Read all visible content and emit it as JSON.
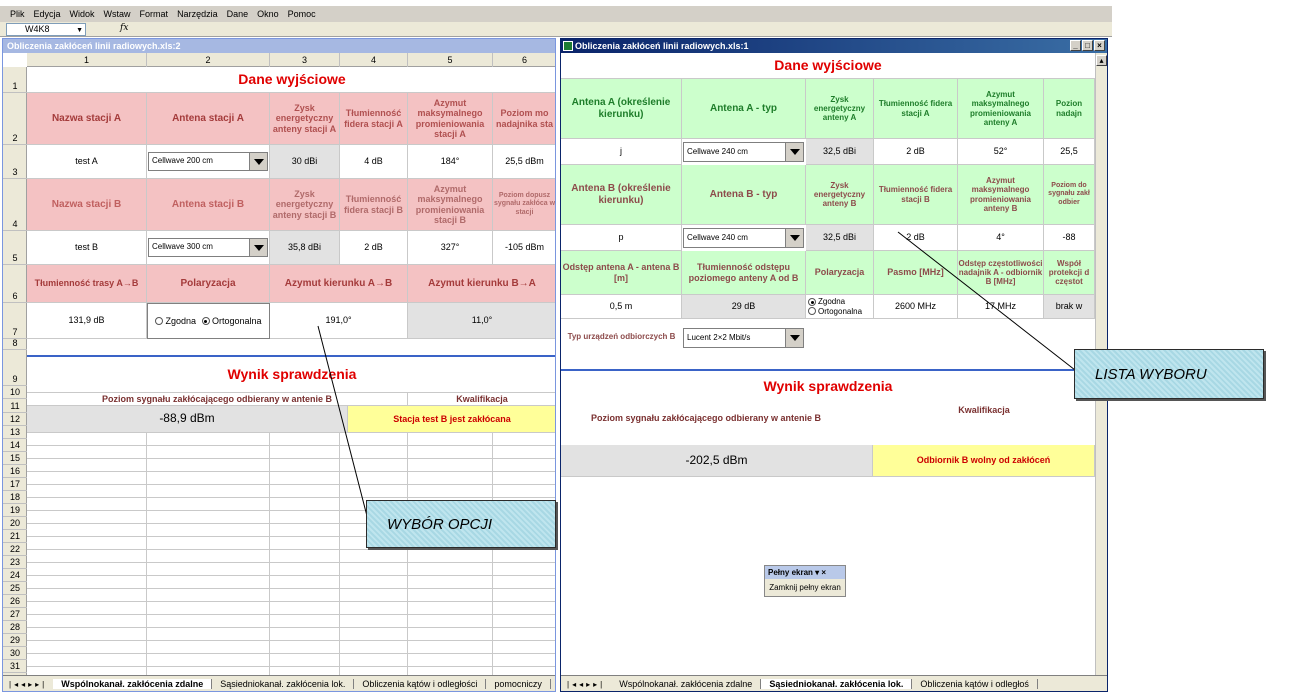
{
  "menu": {
    "items": [
      {
        "label": "Plik",
        "key": "P"
      },
      {
        "label": "Edycja",
        "key": "E"
      },
      {
        "label": "Widok",
        "key": "W"
      },
      {
        "label": "Wstaw",
        "key": "s"
      },
      {
        "label": "Format",
        "key": "F"
      },
      {
        "label": "Narzędzia",
        "key": "N"
      },
      {
        "label": "Dane",
        "key": "D"
      },
      {
        "label": "Okno",
        "key": "O"
      },
      {
        "label": "Pomoc",
        "key": "m"
      }
    ]
  },
  "formula_bar": {
    "name_box": "W4K8",
    "fx": "fx"
  },
  "left_window": {
    "title": "Obliczenia zakłóceń linii radiowych.xls:2",
    "columns": [
      "1",
      "2",
      "3",
      "4",
      "5",
      "6"
    ],
    "rows": [
      "1",
      "2",
      "3",
      "4",
      "5",
      "6",
      "7",
      "8",
      "9",
      "10",
      "11",
      "12",
      "13",
      "14",
      "15",
      "16",
      "17",
      "18",
      "19",
      "20",
      "21",
      "22",
      "23",
      "24",
      "25",
      "26",
      "27",
      "28",
      "29",
      "30",
      "31"
    ],
    "section_title": "Dane wyjściowe",
    "station_a": {
      "h_name": "Nazwa stacji A",
      "h_antenna": "Antena stacji A",
      "h_gain": "Zysk energetyczny anteny stacji A",
      "h_loss": "Tłumienność fidera stacji A",
      "h_azimuth": "Azymut maksymalnego promieniowania stacji A",
      "h_power": "Poziom mo nadajnika sta",
      "name": "test A",
      "antenna": "Cellwave 200 cm",
      "gain": "30 dBi",
      "loss": "4 dB",
      "azimuth": "184°",
      "power": "25,5 dBm"
    },
    "station_b": {
      "h_name": "Nazwa stacji B",
      "h_antenna": "Antena stacji B",
      "h_gain": "Zysk energetyczny anteny stacji B",
      "h_loss": "Tłumienność fidera stacji B",
      "h_azimuth": "Azymut maksymalnego promieniowania stacji B",
      "h_level": "Poziom dopusz sygnału zakłóca w stacji",
      "name": "test B",
      "antenna": "Cellwave 300 cm",
      "gain": "35,8 dBi",
      "loss": "2 dB",
      "azimuth": "327°",
      "level": "-105 dBm"
    },
    "route": {
      "h_attenuation": "Tłumienność trasy A→B",
      "h_polarization": "Polaryzacja",
      "h_az_ab": "Azymut kierunku A→B",
      "h_az_ba": "Azymut kierunku B→A",
      "attenuation": "131,9 dB",
      "pol_opt1": "Zgodna",
      "pol_opt2": "Ortogonalna",
      "az_ab": "191,0°",
      "az_ba": "11,0°"
    },
    "result_title": "Wynik sprawdzenia",
    "h_signal": "Poziom sygnału zakłócającego odbierany w antenie B",
    "h_qual": "Kwalifikacja",
    "signal": "-88,9 dBm",
    "qual": "Stacja test B jest zakłócana",
    "tabs": [
      "Wspólnokanał. zakłócenia zdalne",
      "Sąsiedniokanał. zakłócenia lok.",
      "Obliczenia kątów i odległości",
      "pomocniczy"
    ]
  },
  "right_window": {
    "title": "Obliczenia zakłóceń linii radiowych.xls:1",
    "section_title": "Dane wyjściowe",
    "antenna_a": {
      "h_dir": "Antena A (określenie kierunku)",
      "h_type": "Antena A - typ",
      "h_gain": "Zysk energetyczny anteny A",
      "h_loss": "Tłumienność fidera stacji A",
      "h_azimuth": "Azymut maksymalnego promieniowania anteny A",
      "h_power": "Pozion nadajn",
      "dir": "j",
      "type": "Cellwave 240 cm",
      "gain": "32,5 dBi",
      "loss": "2 dB",
      "azimuth": "52°",
      "power": "25,5"
    },
    "antenna_b": {
      "h_dir": "Antena B (określenie kierunku)",
      "h_type": "Antena B - typ",
      "h_gain": "Zysk energetyczny anteny B",
      "h_loss": "Tłumienność fidera stacji B",
      "h_azimuth": "Azymut maksymalnego promieniowania anteny B",
      "h_level": "Poziom do sygnału zakł odbier",
      "dir": "p",
      "type": "Cellwave 240 cm",
      "gain": "32,5 dBi",
      "loss": "2 dB",
      "azimuth": "4°",
      "level": "-88"
    },
    "link": {
      "h_distance": "Odstęp antena A - antena B [m]",
      "h_hatt": "Tłumienność odstępu poziomego anteny A od B",
      "h_pol": "Polaryzacja",
      "h_band": "Pasmo [MHz]",
      "h_freq": "Odstęp częstotliwości nadajnik A - odbiornik B [MHz]",
      "h_prot": "Współ protekcji d częstot",
      "distance": "0,5 m",
      "hatt": "29 dB",
      "pol_opt1": "Zgodna",
      "pol_opt2": "Ortogonalna",
      "band": "2600 MHz",
      "freq": "17 MHz",
      "prot": "brak w"
    },
    "receiver_label": "Typ urządzeń odbiorczych B",
    "receiver": "Lucent 2×2 Mbit/s",
    "result_title": "Wynik sprawdzenia",
    "h_signal": "Poziom sygnału zakłócającego odbierany w antenie B",
    "h_qual": "Kwalifikacja",
    "signal": "-202,5 dBm",
    "qual": "Odbiornik B wolny od zakłóceń",
    "tabs": [
      "Wspólnokanał. zakłócenia zdalne",
      "Sąsiedniokanał. zakłócenia lok.",
      "Obliczenia kątów i odległoś"
    ]
  },
  "callouts": {
    "option": "WYBÓR OPCJI",
    "list": "LISTA WYBORU"
  },
  "fullscreen": {
    "title": "Pełny ekran",
    "close": "Zamknij pełny ekran"
  }
}
